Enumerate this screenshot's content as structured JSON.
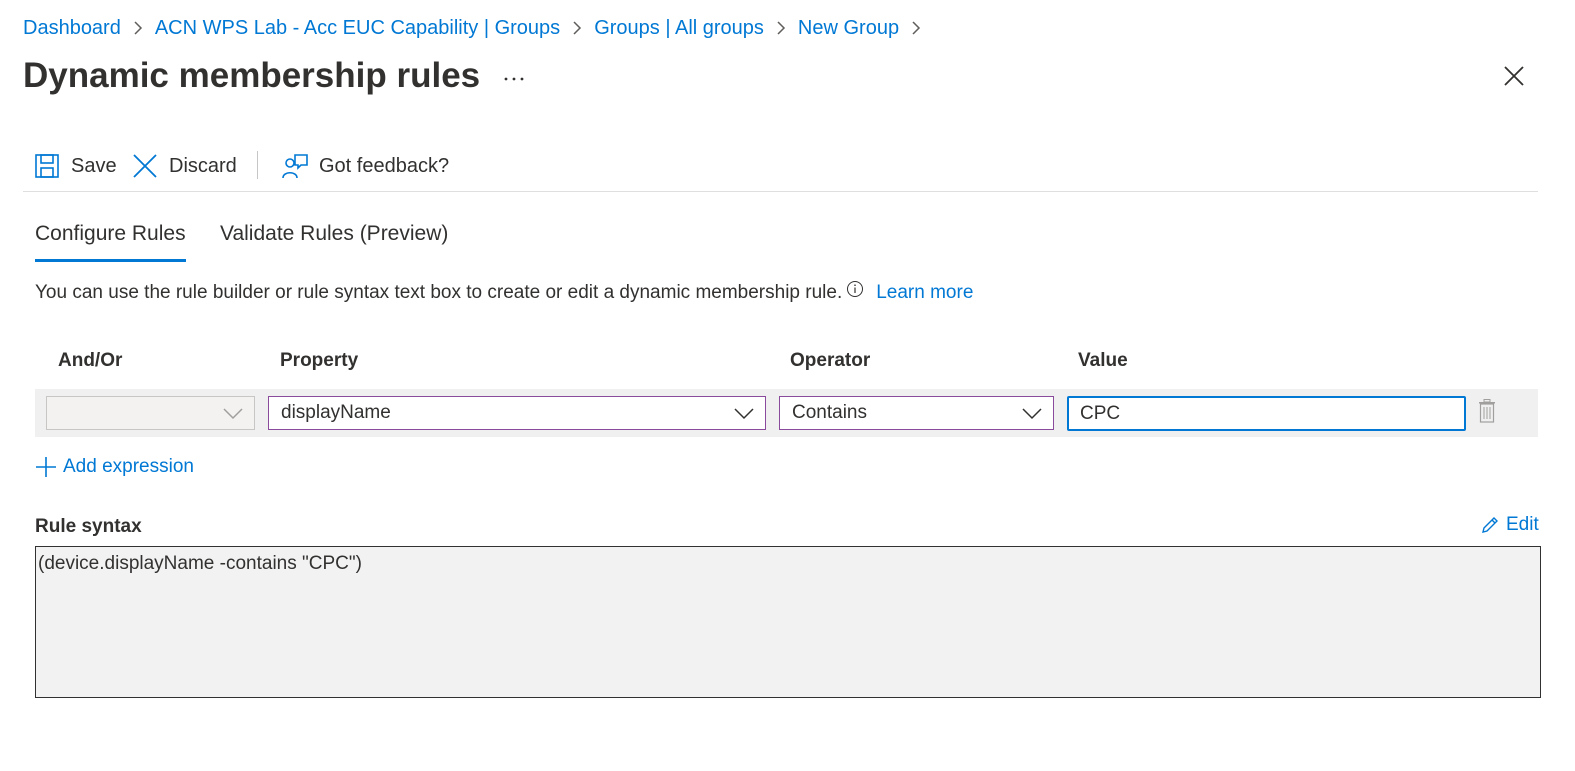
{
  "breadcrumb": [
    {
      "label": "Dashboard"
    },
    {
      "label": "ACN WPS Lab - Acc EUC Capability | Groups"
    },
    {
      "label": "Groups | All groups"
    },
    {
      "label": "New Group"
    }
  ],
  "page": {
    "title": "Dynamic membership rules",
    "more_label": "···"
  },
  "toolbar": {
    "save_label": "Save",
    "discard_label": "Discard",
    "feedback_label": "Got feedback?"
  },
  "tabs": [
    {
      "label": "Configure Rules",
      "active": true
    },
    {
      "label": "Validate Rules (Preview)",
      "active": false
    }
  ],
  "description": {
    "text": "You can use the rule builder or rule syntax text box to create or edit a dynamic membership rule.",
    "learn_more": "Learn more"
  },
  "builder": {
    "columns": {
      "andor": "And/Or",
      "property": "Property",
      "operator": "Operator",
      "value": "Value"
    },
    "rows": [
      {
        "andor": "",
        "property": "displayName",
        "operator": "Contains",
        "value": "CPC"
      }
    ],
    "add_expression_label": "Add expression"
  },
  "rule_syntax": {
    "label": "Rule syntax",
    "edit_label": "Edit",
    "text": "(device.displayName -contains \"CPC\")"
  },
  "colors": {
    "accent": "#0078d4",
    "dropdown_focus_border": "#8a4b9c",
    "row_background": "#f0f0f0"
  }
}
